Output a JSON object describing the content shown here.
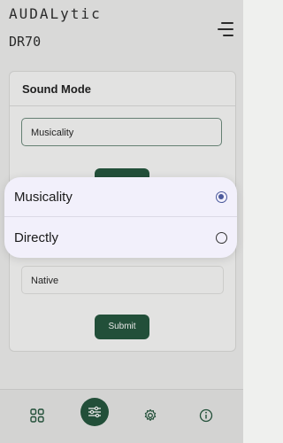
{
  "header": {
    "brand": "AUDALytic",
    "device_name": "DR70",
    "menu_icon": "hamburger-menu-icon"
  },
  "card": {
    "title": "Sound Mode",
    "selected_value": "Musicality",
    "second_value": "Native",
    "submit_label": "Submit"
  },
  "dialog": {
    "options": [
      {
        "label": "Musicality",
        "selected": true
      },
      {
        "label": "Directly",
        "selected": false
      }
    ]
  },
  "bottom_nav": {
    "items": [
      {
        "icon": "grid-icon"
      },
      {
        "icon": "sliders-icon",
        "active": true
      },
      {
        "icon": "gear-icon"
      },
      {
        "icon": "info-icon"
      }
    ]
  },
  "colors": {
    "accent": "#1f5339",
    "radio_selected": "#4c5a9c",
    "dialog_bg": "#f2f0fb"
  }
}
